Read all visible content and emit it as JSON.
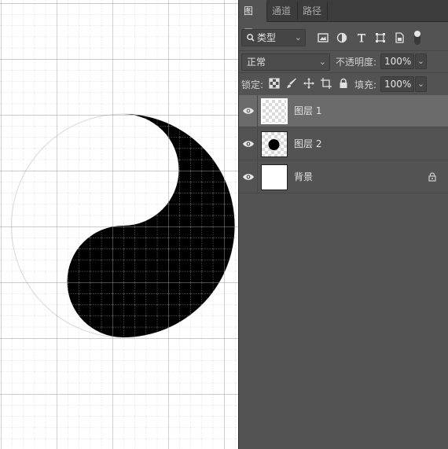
{
  "tabs": [
    {
      "label": "图层",
      "active": true
    },
    {
      "label": "通道",
      "active": false
    },
    {
      "label": "路径",
      "active": false
    }
  ],
  "filter": {
    "kind_label": "类型",
    "icons": [
      "image-filter-icon",
      "adjustment-filter-icon",
      "type-filter-icon",
      "shape-filter-icon",
      "smart-object-filter-icon",
      "filter-toggle-icon"
    ]
  },
  "blend": {
    "mode": "正常",
    "opacity_label": "不透明度:",
    "opacity": "100%"
  },
  "lock": {
    "label": "锁定:",
    "icons": [
      "lock-transparent-pixels-icon",
      "lock-image-pixels-icon",
      "lock-position-icon",
      "lock-artboard-icon",
      "lock-all-icon"
    ],
    "fill_label": "填充:",
    "fill": "100%"
  },
  "layers": [
    {
      "name": "图层 1",
      "selected": true,
      "thumb": "transparent"
    },
    {
      "name": "图层 2",
      "selected": false,
      "thumb": "black-dot"
    },
    {
      "name": "背景",
      "selected": false,
      "thumb": "white",
      "locked": true
    }
  ],
  "colors": {
    "panel_bg": "#535353",
    "tabbar_bg": "#3c3c3c",
    "selected_layer": "#6b6b6b",
    "canvas_bg": "#ffffff",
    "shape_fill": "#000000"
  }
}
